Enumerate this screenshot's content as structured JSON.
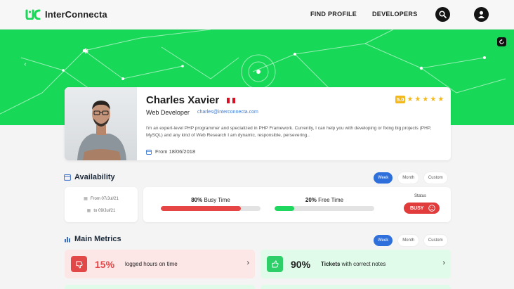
{
  "app": {
    "name": "InterConnecta"
  },
  "nav": {
    "find_profile": "FIND PROFILE",
    "developers": "DEVELOPERS",
    "search_icon": "search-icon",
    "account_icon": "user-circle-icon"
  },
  "profile": {
    "name": "Charles Xavier",
    "flag_colors": [
      "#d91023",
      "#ffffff",
      "#d91023"
    ],
    "role": "Web Developer",
    "email": "charles@interconnecta.com",
    "rating": "5.0",
    "stars": 5,
    "bio": "I'm an expert-level PHP programmer and specialized in PHP Framework. Currently, I can help you with developing or fixing big projects (PHP, MySQL) and any kind of Web Research I am dynamic, responsible, persevering..",
    "since": "From 18/06/2018"
  },
  "availability": {
    "title": "Availability",
    "tabs": [
      "Week",
      "Month",
      "Custom"
    ],
    "active_tab": "Week",
    "from": "From 07/Jul/21",
    "to": "to 09/Jul/21",
    "busy": {
      "percent": "80%",
      "label": " Busy Time",
      "value": 0.8,
      "color": "#e64545"
    },
    "free": {
      "percent": "20%",
      "label": " Free Time",
      "value": 0.2,
      "color": "#1fd65f"
    },
    "status_label": "Status",
    "status": "BUSY"
  },
  "metrics": {
    "title": "Main Metrics",
    "tabs": [
      "Week",
      "Month",
      "Custom"
    ],
    "active_tab": "Week",
    "items": [
      {
        "value": "15%",
        "label": "logged hours on time",
        "bold": "",
        "bg": "#fde6e6",
        "icon_bg": "#e24848",
        "color": "#e24848",
        "icon": "thumbs-down-icon"
      },
      {
        "value": "90%",
        "label": " with correct notes",
        "bold": "Tickets",
        "bg": "#e0fbe9",
        "icon_bg": "#2ecf68",
        "color": "#1d1d1d",
        "icon": "thumbs-up-icon"
      }
    ]
  },
  "colors": {
    "brand": "#17d957",
    "accent": "#2e6fdc",
    "danger": "#e13b3b"
  }
}
